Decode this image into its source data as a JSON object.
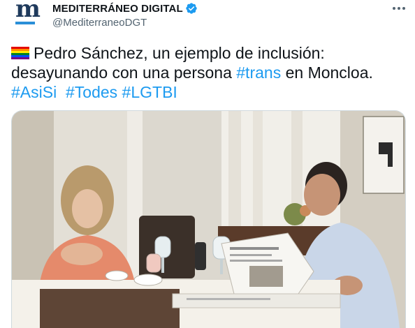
{
  "tweet": {
    "author": {
      "display_name": "MEDITERRÁNEO DIGITAL",
      "handle": "@MediterraneoDGT",
      "avatar_letter": "m",
      "verified": true
    },
    "text": {
      "emoji": "rainbow-flag-icon",
      "line1": "Pedro Sánchez, un ejemplo de inclusión:",
      "line2_prefix": "desayunando con una persona ",
      "line2_hashtag": "#trans",
      "line2_suffix": " en Moncloa.",
      "hashtags": [
        "#AsiSi",
        "#Todes",
        "#LGTBI"
      ]
    },
    "media": {
      "type": "photo"
    }
  },
  "colors": {
    "accent": "#1d9bf0",
    "brand": "#1f5f8a",
    "text_primary": "#0f1419",
    "text_secondary": "#536471"
  }
}
